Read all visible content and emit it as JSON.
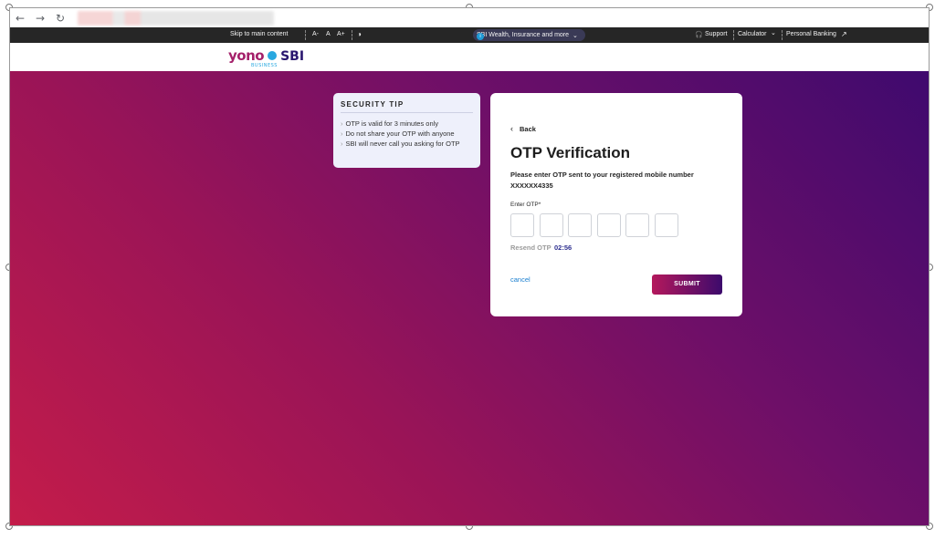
{
  "browser": {
    "back_icon": "arrow-left-icon",
    "forward_icon": "arrow-right-icon",
    "reload_icon": "reload-icon"
  },
  "topbar": {
    "skip_link": "Skip to main content",
    "font_decrease": "A-",
    "font_normal": "A",
    "font_increase": "A+",
    "contrast_icon": "contrast-icon",
    "wealth_label": "SBI Wealth, Insurance and more",
    "support": "Support",
    "calculator": "Calculator",
    "personal_banking": "Personal Banking"
  },
  "logo": {
    "yono": "yono",
    "sbi": "SBI",
    "business": "BUSINESS"
  },
  "security_tip": {
    "title": "SECURITY TIP",
    "items": [
      "OTP is valid for 3 minutes only",
      "Do not share your OTP with anyone",
      "SBI will never call you asking for OTP"
    ]
  },
  "otp": {
    "back_label": "Back",
    "title": "OTP Verification",
    "description": "Please enter OTP sent to your registered mobile number",
    "mobile": "XXXXXX4335",
    "label": "Enter OTP*",
    "resend_label": "Resend OTP",
    "timer": "02:56",
    "cancel_label": "cancel",
    "submit_label": "SUBMIT"
  },
  "colors": {
    "gradient_start": "#c41c4a",
    "gradient_end": "#3f0a6e",
    "accent": "#2d2f8f",
    "link": "#1a7fd0"
  }
}
